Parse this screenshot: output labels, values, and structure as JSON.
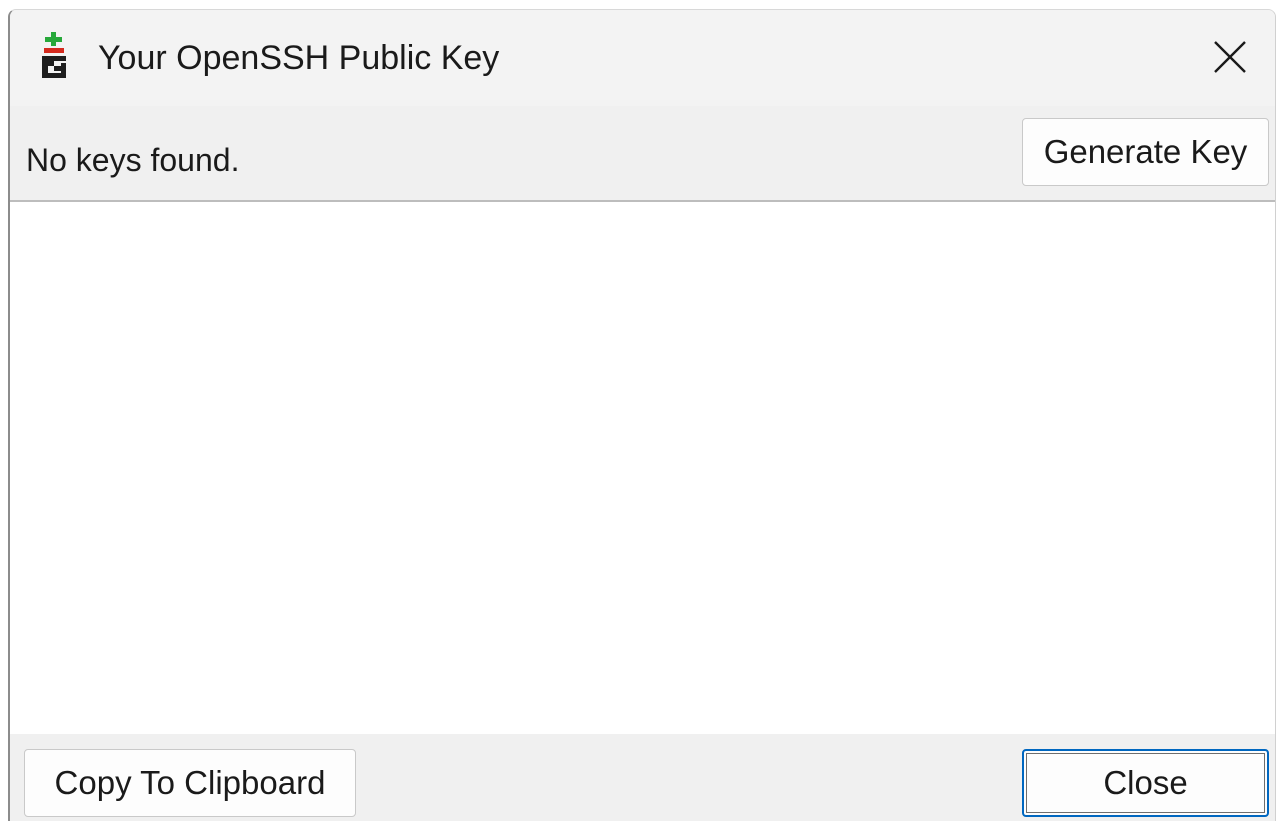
{
  "window": {
    "title": "Your OpenSSH Public Key",
    "app_icon": "gpg4win-key-icon",
    "close_icon": "close-icon"
  },
  "toolbar": {
    "status_text": "No keys found.",
    "generate_label": "Generate Key"
  },
  "key_area": {
    "value": ""
  },
  "footer": {
    "copy_label": "Copy To Clipboard",
    "close_label": "Close"
  },
  "colors": {
    "window_bg": "#f0f0f0",
    "content_bg": "#ffffff",
    "focus_border": "#0067c0",
    "icon_green": "#27a83a",
    "icon_red": "#d42a1e",
    "icon_dark": "#1e1e1e"
  }
}
